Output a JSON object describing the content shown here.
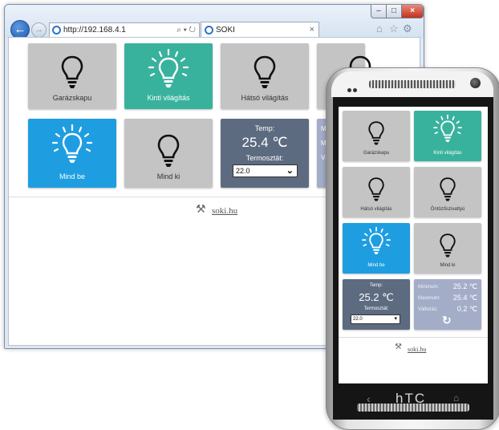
{
  "browser": {
    "url": "http://192.168.4.1",
    "address_tools": "⌕ ▾ ↻",
    "tab_title": "SOKI",
    "tab_close": "×",
    "controls": {
      "minimize": "–",
      "maximize": "□",
      "close": "×"
    },
    "back": "←",
    "forward": "→",
    "toolbar_icons": [
      "home-icon",
      "star-icon",
      "gear-icon"
    ],
    "toolbar_glyphs": {
      "home": "⌂",
      "star": "☆",
      "gear": "⚙"
    }
  },
  "desktop": {
    "tiles": {
      "garage": {
        "label": "Garázskapu",
        "icon": "bulb-off-icon",
        "state": "off"
      },
      "outdoor": {
        "label": "Kinti világítás",
        "icon": "bulb-on-icon",
        "state": "on"
      },
      "back_light": {
        "label": "Hátsó világítás",
        "icon": "bulb-off-icon",
        "state": "off"
      },
      "all_on": {
        "label": "Mind be",
        "icon": "bulb-on-icon"
      },
      "all_off": {
        "label": "Mind ki",
        "icon": "bulb-off-icon"
      }
    },
    "thermo": {
      "temp_label": "Temp:",
      "temp_value": "25.4 ℃",
      "thermostat_label": "Termosztát:",
      "setpoint": "22.0",
      "arrow": "⌄"
    },
    "stats_partial": {
      "min": "Mi",
      "max": "Ma",
      "change": "Vá"
    },
    "footer": {
      "link": "soki.hu",
      "icon": "wrench-icon",
      "wrench_glyph": "⚒"
    }
  },
  "phone": {
    "tiles": {
      "garage": {
        "label": "Garázskapu",
        "state": "off"
      },
      "outdoor": {
        "label": "Kinti világítás",
        "state": "on"
      },
      "back_light": {
        "label": "Hátsó világítás",
        "state": "off"
      },
      "irrigation": {
        "label": "Öntözőszivattyú",
        "state": "off"
      },
      "all_on": {
        "label": "Mind be"
      },
      "all_off": {
        "label": "Mind ki"
      }
    },
    "thermo": {
      "temp_label": "Temp:",
      "temp_value": "25.2 ℃",
      "thermostat_label": "Termosztát:",
      "setpoint": "22.0",
      "arrow": "▾"
    },
    "stats": {
      "min_label": "Minimum:",
      "min_value": "25.2 ℃",
      "max_label": "Maximum:",
      "max_value": "25.4 ℃",
      "change_label": "Változás:",
      "change_value": "0.2 ℃",
      "refresh_icon": "refresh-icon",
      "refresh_glyph": "↻"
    },
    "footer": {
      "link": "soki.hu",
      "icon": "wrench-icon",
      "wrench_glyph": "⚒"
    },
    "navbar": {
      "brand": "hTC",
      "back_glyph": "‹",
      "home_glyph": "⌂"
    }
  },
  "colors": {
    "teal": "#39b29d",
    "blue": "#1e9ee0",
    "gray": "#c4c4c4",
    "slate": "#5c6b80",
    "lavender": "#a4adc8"
  }
}
